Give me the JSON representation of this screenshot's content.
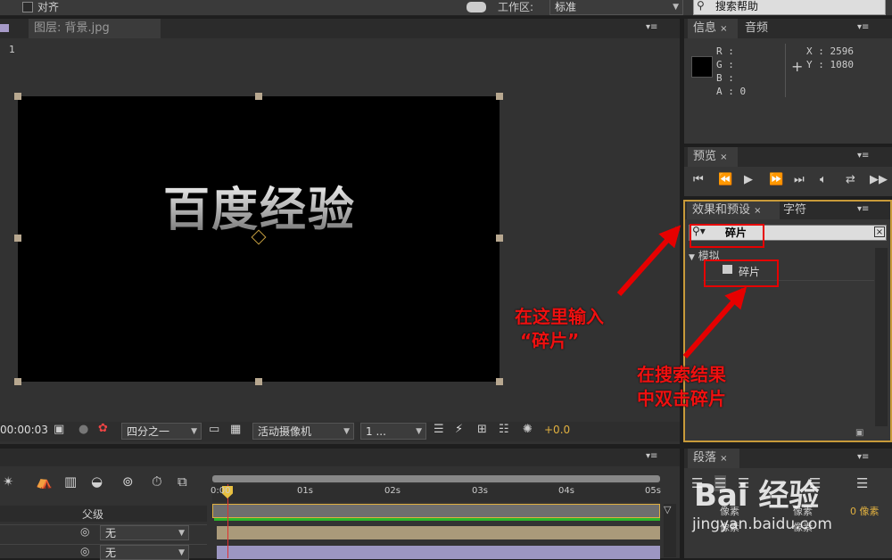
{
  "top_toolbar": {
    "align_label": "对齐",
    "workspace_label": "工作区:",
    "workspace_value": "标准",
    "search_placeholder": "搜索帮助"
  },
  "composition": {
    "tab_label": "图层: 背景.jpg",
    "breadcrumb": "1",
    "text": "百度经验",
    "timecode": "00:00:03",
    "resolution": "四分之一",
    "camera": "活动摄像机",
    "views": "1 ...",
    "exposure": "+0.0"
  },
  "info_panel": {
    "tabs": [
      "信息",
      "音频"
    ],
    "labels": [
      "R :",
      "G :",
      "B :",
      "A : 0"
    ],
    "x": "X : 2596",
    "y": "Y : 1080"
  },
  "preview_panel": {
    "tab": "预览"
  },
  "effects_panel": {
    "tabs": [
      "效果和预设",
      "字符"
    ],
    "search_value": "碎片",
    "category": "模拟",
    "result": "碎片"
  },
  "paragraph_panel": {
    "tab": "段落",
    "labels": [
      "像素",
      "像素",
      "0 像素",
      "像素",
      "像素"
    ]
  },
  "timeline": {
    "parent_header": "父级",
    "ticks": [
      "0:00",
      "01s",
      "02s",
      "03s",
      "04s",
      "05s"
    ],
    "rows": [
      {
        "parent": "无"
      },
      {
        "parent": "无"
      }
    ]
  },
  "annotations": {
    "note1_line1": "在这里输入",
    "note1_line2": "“碎片”",
    "note2_line1": "在搜索结果",
    "note2_line2": "中双击碎片"
  },
  "watermark": {
    "text": "Bai 经验",
    "url": "jingyan.baidu.com"
  },
  "colors": {
    "accent_red": "#e60000",
    "orange_frame": "#c89a3a",
    "playhead": "#e8c040",
    "green_bar": "#2bb52b"
  }
}
